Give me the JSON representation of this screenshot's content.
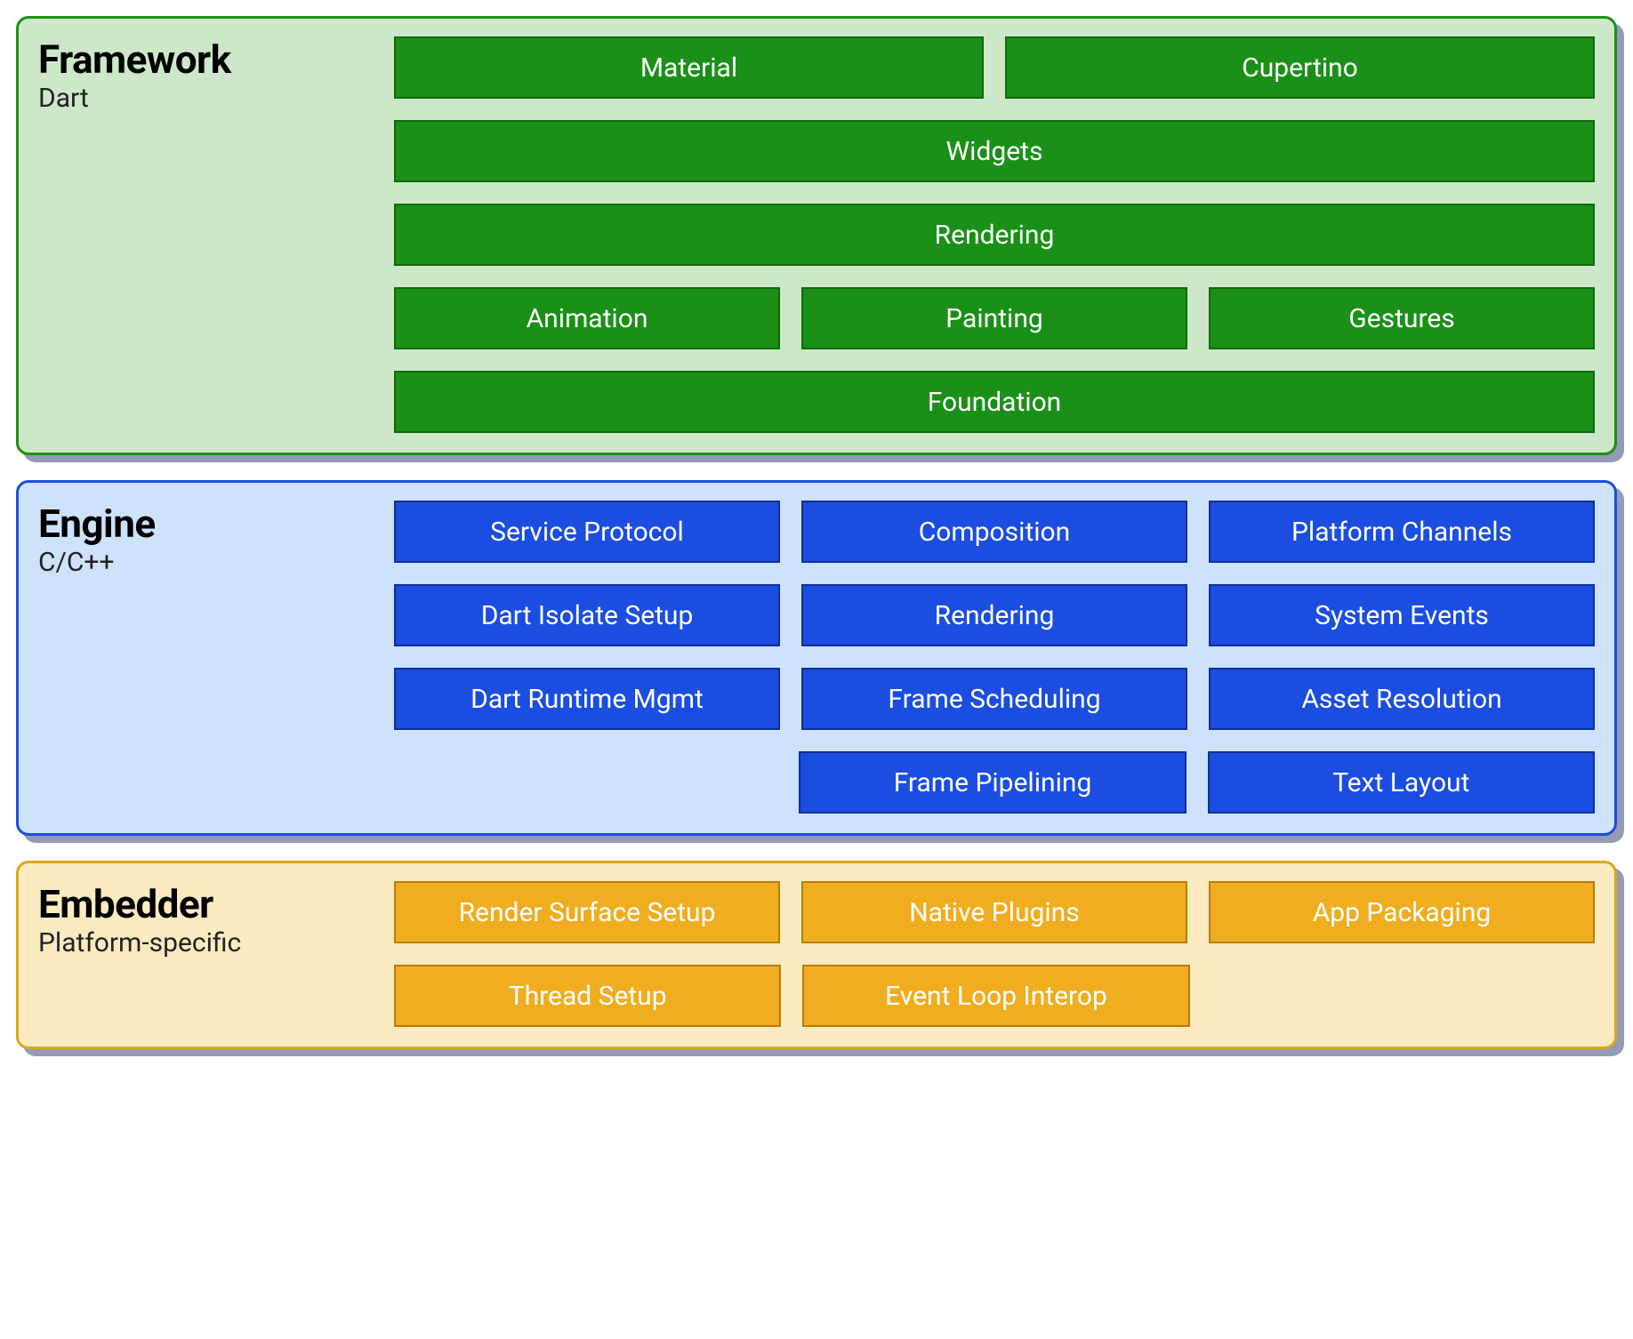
{
  "layers": {
    "framework": {
      "title": "Framework",
      "subtitle": "Dart",
      "rows": [
        [
          "Material",
          "Cupertino"
        ],
        [
          "Widgets"
        ],
        [
          "Rendering"
        ],
        [
          "Animation",
          "Painting",
          "Gestures"
        ],
        [
          "Foundation"
        ]
      ]
    },
    "engine": {
      "title": "Engine",
      "subtitle": "C/C++",
      "rows": [
        [
          "Service Protocol",
          "Composition",
          "Platform Channels"
        ],
        [
          "Dart Isolate Setup",
          "Rendering",
          "System Events"
        ],
        [
          "Dart Runtime Mgmt",
          "Frame Scheduling",
          "Asset Resolution"
        ],
        [
          "",
          "Frame Pipelining",
          "Text Layout"
        ]
      ]
    },
    "embedder": {
      "title": "Embedder",
      "subtitle": "Platform-specific",
      "rows": [
        [
          "Render Surface Setup",
          "Native Plugins",
          "App Packaging"
        ],
        [
          "Thread Setup",
          "Event Loop Interop",
          ""
        ]
      ]
    }
  },
  "colors": {
    "framework_bg": "#cde8c8",
    "framework_border": "#1b9018",
    "framework_cell": "#1b9018",
    "engine_bg": "#cfe2fb",
    "engine_border": "#1b4de0",
    "engine_cell": "#1b4de0",
    "embedder_bg": "#fcebc0",
    "embedder_border": "#dba720",
    "embedder_cell": "#f0ad1f"
  }
}
